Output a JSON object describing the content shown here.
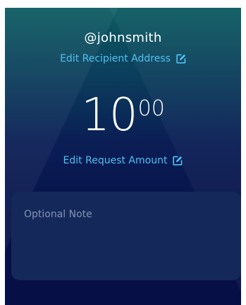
{
  "recipient": {
    "handle": "@johnsmith",
    "edit_label": "Edit Recipient Address",
    "edit_icon": "edit-icon"
  },
  "request": {
    "amount_whole": "10",
    "amount_cents": "00",
    "edit_label": "Edit Request Amount",
    "edit_icon": "edit-icon"
  },
  "note": {
    "placeholder": "Optional Note",
    "value": ""
  },
  "colors": {
    "accent": "#4fc0f2",
    "background_top": "#0d5c62",
    "background_bottom": "#061046",
    "note_panel": "#14295a",
    "placeholder": "#8392b3"
  }
}
